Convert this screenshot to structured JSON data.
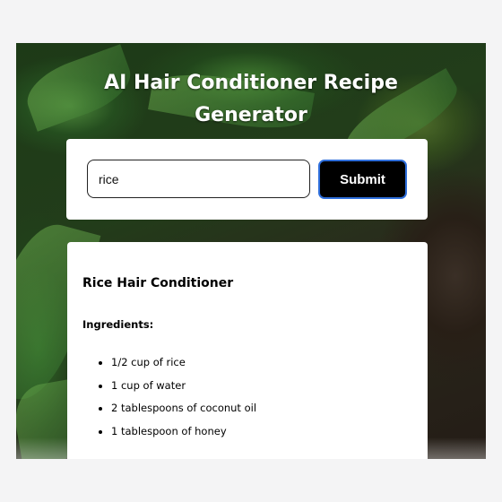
{
  "header": {
    "title_line1": "AI Hair Conditioner Recipe",
    "title_line2": "Generator"
  },
  "form": {
    "input_value": "rice",
    "submit_label": "Submit"
  },
  "recipe": {
    "title": "Rice Hair Conditioner",
    "ingredients_heading": "Ingredients:",
    "ingredients": [
      "1/2 cup of rice",
      "1 cup of water",
      "2 tablespoons of coconut oil",
      "1 tablespoon of honey"
    ]
  }
}
